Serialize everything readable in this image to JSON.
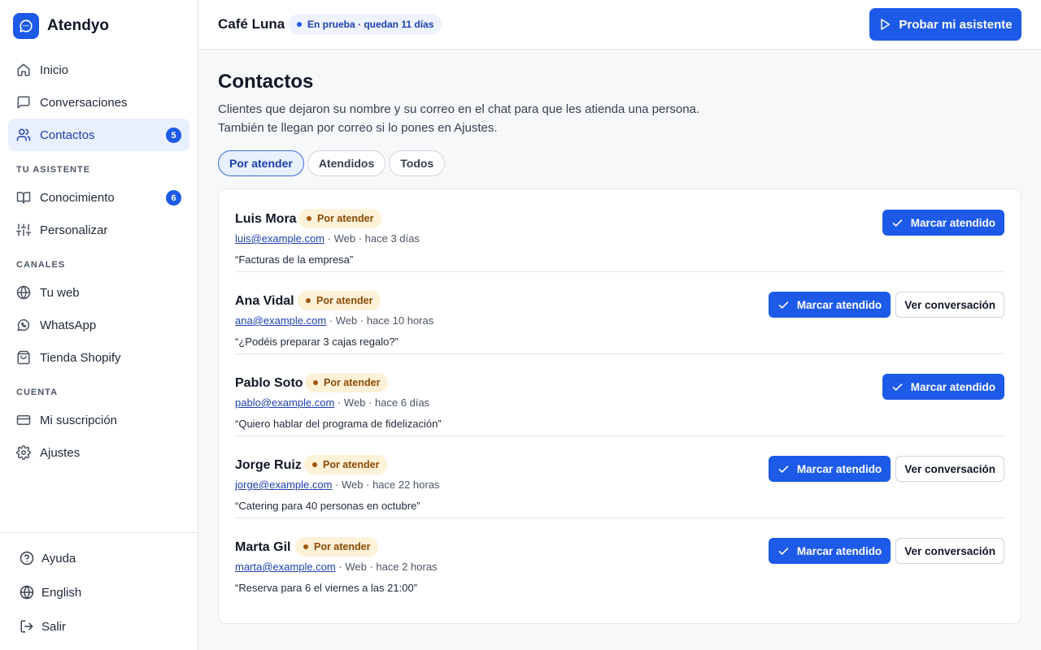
{
  "app": {
    "name": "Atendyo"
  },
  "sidebar": {
    "items": [
      {
        "label": "Inicio",
        "icon": "home-icon"
      },
      {
        "label": "Conversaciones",
        "icon": "chat-icon"
      },
      {
        "label": "Contactos",
        "icon": "users-icon",
        "badge": "5",
        "active": true
      }
    ],
    "sections": [
      {
        "title": "TU ASISTENTE",
        "items": [
          {
            "label": "Conocimiento",
            "icon": "book-icon",
            "badge": "6"
          },
          {
            "label": "Personalizar",
            "icon": "sliders-icon"
          }
        ]
      },
      {
        "title": "CANALES",
        "items": [
          {
            "label": "Tu web",
            "icon": "globe-icon"
          },
          {
            "label": "WhatsApp",
            "icon": "whatsapp-icon"
          },
          {
            "label": "Tienda Shopify",
            "icon": "shopping-bag-icon"
          }
        ]
      },
      {
        "title": "CUENTA",
        "items": [
          {
            "label": "Mi suscripción",
            "icon": "credit-card-icon"
          },
          {
            "label": "Ajustes",
            "icon": "gear-icon"
          }
        ]
      }
    ],
    "bottom": [
      {
        "label": "Ayuda",
        "icon": "help-circle-icon"
      },
      {
        "label": "English",
        "icon": "globe-icon"
      },
      {
        "label": "Salir",
        "icon": "logout-icon"
      }
    ]
  },
  "header": {
    "business": "Café Luna",
    "trial": "En prueba · quedan 11 días",
    "try_button": "Probar mi asistente"
  },
  "page": {
    "title": "Contactos",
    "description_line1": "Clientes que dejaron su nombre y su correo en el chat para que les atienda una persona.",
    "description_line2": "También te llegan por correo si lo pones en Ajustes.",
    "tabs": [
      {
        "label": "Por atender",
        "active": true
      },
      {
        "label": "Atendidos"
      },
      {
        "label": "Todos"
      }
    ]
  },
  "contacts": [
    {
      "name": "Luis Mora",
      "status": "Por atender",
      "email": "luis@example.com",
      "source": "Web",
      "time": "hace 3 días",
      "quote": "“Facturas de la empresa”",
      "done_label": "Marcar atendido",
      "view_label": ""
    },
    {
      "name": "Ana Vidal",
      "status": "Por atender",
      "email": "ana@example.com",
      "source": "Web",
      "time": "hace 10 horas",
      "quote": "“¿Podéis preparar 3 cajas regalo?”",
      "done_label": "Marcar atendido",
      "view_label": "Ver conversación"
    },
    {
      "name": "Pablo Soto",
      "status": "Por atender",
      "email": "pablo@example.com",
      "source": "Web",
      "time": "hace 6 días",
      "quote": "“Quiero hablar del programa de fidelización”",
      "done_label": "Marcar atendido",
      "view_label": ""
    },
    {
      "name": "Jorge Ruiz",
      "status": "Por atender",
      "email": "jorge@example.com",
      "source": "Web",
      "time": "hace 22 horas",
      "quote": "“Catering para 40 personas en octubre”",
      "done_label": "Marcar atendido",
      "view_label": "Ver conversación"
    },
    {
      "name": "Marta Gil",
      "status": "Por atender",
      "email": "marta@example.com",
      "source": "Web",
      "time": "hace 2 horas",
      "quote": "“Reserva para 6 el viernes a las 21:00”",
      "done_label": "Marcar atendido",
      "view_label": "Ver conversación"
    }
  ],
  "colors": {
    "accent": "#1d5ae8",
    "status_bg": "#fdf1d8",
    "status_text": "#8a4a05"
  }
}
